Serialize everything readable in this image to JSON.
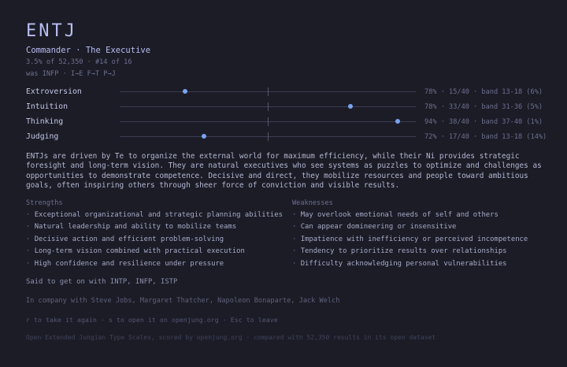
{
  "header": {
    "title": "ENTJ",
    "subtitle": "Commander · The Executive",
    "meta1": "3.5% of 52,350 · #14 of 16",
    "meta2": "was INFP · I→E F→T P→J"
  },
  "scales": [
    {
      "label": "Extroversion",
      "percent": 78,
      "position": 0.22,
      "stats": "78% · 15/40 · band 13-18 (6%)"
    },
    {
      "label": "Intuition",
      "percent": 78,
      "position": 0.78,
      "stats": "78% · 33/40 · band 31-36 (5%)"
    },
    {
      "label": "Thinking",
      "percent": 94,
      "position": 0.94,
      "stats": "94% · 38/40 · band 37-40 (1%)"
    },
    {
      "label": "Judging",
      "percent": 72,
      "position": 0.285,
      "stats": "72% · 17/40 · band 13-18 (14%)"
    }
  ],
  "description": "ENTJs are driven by Te to organize the external world for maximum efficiency, while their Ni provides strategic foresight and long-term vision. They are natural executives who see systems as puzzles to optimize and challenges as opportunities to demonstrate competence. Decisive and direct, they mobilize resources and people toward ambitious goals, often inspiring others through sheer force of conviction and visible results.",
  "strengths": {
    "heading": "Strengths",
    "items": [
      "Exceptional organizational and strategic planning abilities",
      "Natural leadership and ability to mobilize teams",
      "Decisive action and efficient problem-solving",
      "Long-term vision combined with practical execution",
      "High confidence and resilience under pressure"
    ]
  },
  "weaknesses": {
    "heading": "Weaknesses",
    "items": [
      "May overlook emotional needs of self and others",
      "Can appear domineering or insensitive",
      "Impatience with inefficiency or perceived incompetence",
      "Tendency to prioritize results over relationships",
      "Difficulty acknowledging personal vulnerabilities"
    ]
  },
  "bullet": "·",
  "said": "Said to get on with INTP, INFP, ISTP",
  "company": "In company with Steve Jobs, Margaret Thatcher, Napoleon Bonaparte, Jack Welch",
  "hint": "r to take it again · s to open it on openjung.org · Esc to leave",
  "footer": "Open Extended Jungian Type Scales, scored by openjung.org · compared with 52,350 results in its open dataset",
  "colors": {
    "background": "#1b1c26",
    "accent": "#7aa3f0",
    "title": "#b9bdf2"
  }
}
